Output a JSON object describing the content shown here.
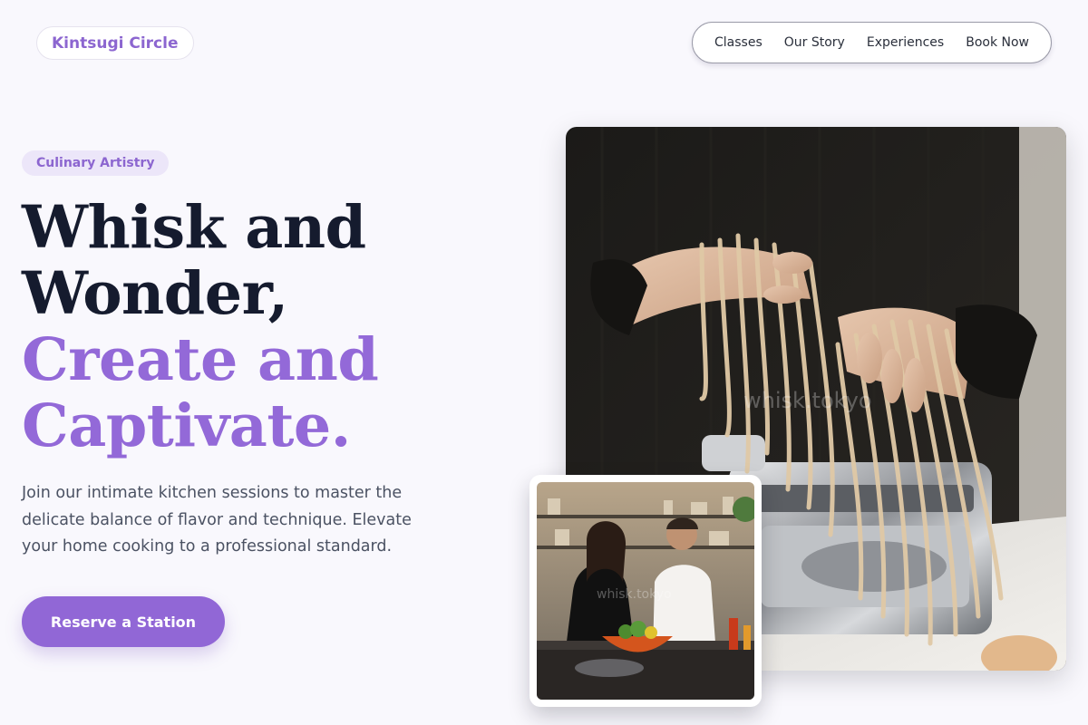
{
  "header": {
    "brand": "Kintsugi Circle",
    "nav": [
      "Classes",
      "Our Story",
      "Experiences",
      "Book Now"
    ]
  },
  "hero": {
    "tag": "Culinary Artistry",
    "title_line1": "Whisk and",
    "title_line2": "Wonder,",
    "title_line3": "Create and",
    "title_line4": "Captivate.",
    "description": "Join our intimate kitchen sessions to master the delicate balance of flavor and technique. Elevate your home cooking to a professional standard.",
    "cta_label": "Reserve a Station"
  },
  "images": {
    "main_alt": "Hands holding fresh pasta over a pasta machine",
    "secondary_alt": "Couple cooking together in a kitchen",
    "watermark": "whisk.tokyo"
  },
  "colors": {
    "accent": "#9369d8",
    "heading": "#151b2e",
    "background": "#f9f8fd"
  }
}
